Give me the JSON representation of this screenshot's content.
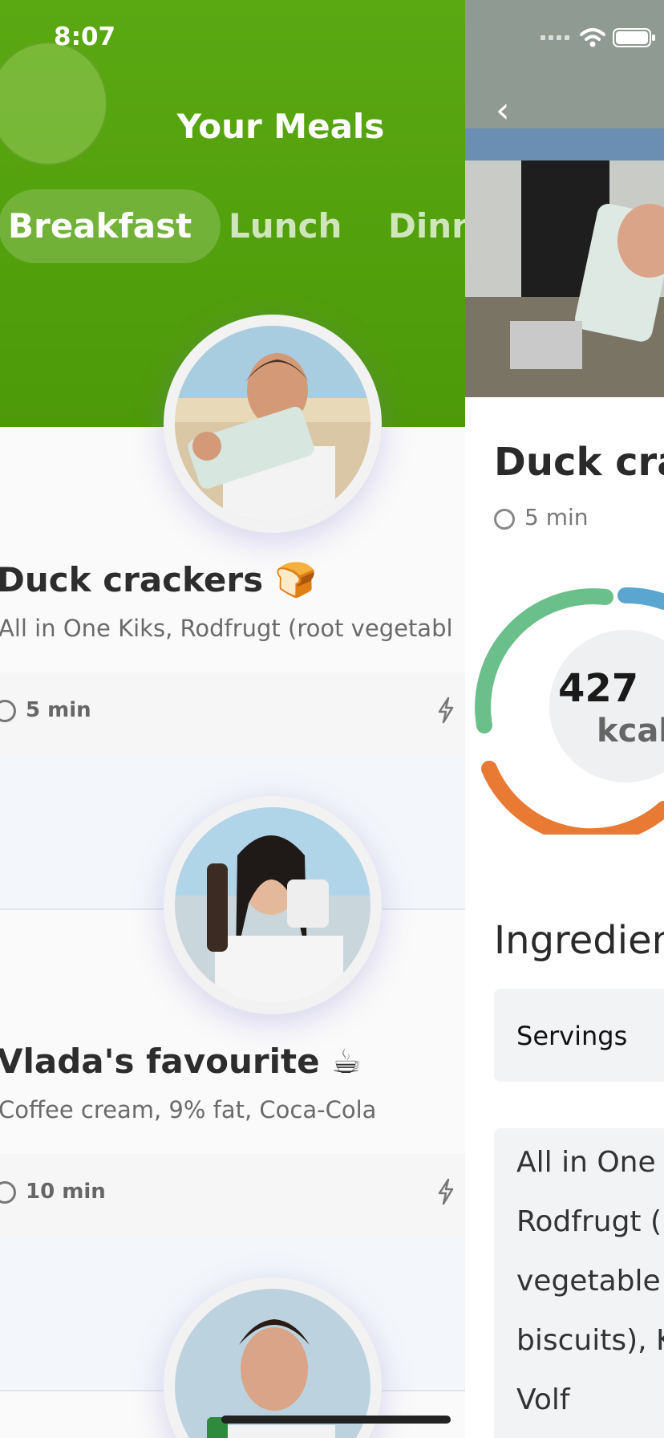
{
  "status_bar": {
    "time": "8:07"
  },
  "header": {
    "title": "Your Meals",
    "tabs": [
      {
        "label": "Breakfast",
        "active": true
      },
      {
        "label": "Lunch",
        "active": false
      },
      {
        "label": "Dinn",
        "active": false
      }
    ]
  },
  "meals": [
    {
      "title": "Duck crackers 🍞",
      "ingredients": "All in One Kiks, Rodfrugt (root vegetabl",
      "duration": "5 min"
    },
    {
      "title": "Vlada's favourite ☕",
      "ingredients": "Coffee cream, 9% fat, Coca-Cola",
      "duration": "10 min"
    }
  ],
  "detail": {
    "title": "Duck cra",
    "duration": "5 min",
    "kcal_value": "427",
    "kcal_unit": "kcal",
    "ingredients_heading": "Ingredien",
    "servings_label": "Servings",
    "ingredient_lines": [
      "All in One K",
      "Rodfrugt (r",
      "vegetable",
      "biscuits), K",
      "Volf"
    ]
  },
  "colors": {
    "brand_green": "#4d9a09",
    "ring_green": "#6bbf8a",
    "ring_blue": "#5aa6d0",
    "ring_orange": "#e87a33"
  }
}
